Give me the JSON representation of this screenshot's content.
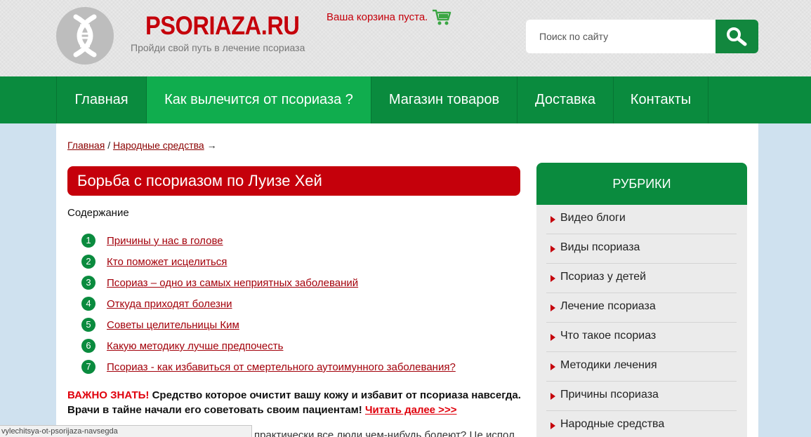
{
  "header": {
    "site_title": "PSORIAZA.RU",
    "tagline": "Пройди свой путь в лечение псориаза",
    "cart_text": "Ваша корзина пуста.",
    "search_placeholder": "Поиск по сайту"
  },
  "nav": {
    "items": [
      {
        "label": "Главная"
      },
      {
        "label": "Как вылечится от псориаза ?"
      },
      {
        "label": "Магазин товаров"
      },
      {
        "label": "Доставка"
      },
      {
        "label": "Контакты"
      }
    ]
  },
  "breadcrumb": {
    "home": "Главная",
    "sep": "/",
    "section": "Народные средства",
    "arrow": "→"
  },
  "article": {
    "title": "Борьба с псориазом по Луизе Хей",
    "toc_label": "Содержание",
    "toc": [
      {
        "num": "1",
        "label": "Причины у нас в голове"
      },
      {
        "num": "2",
        "label": "Кто поможет исцелиться"
      },
      {
        "num": "3",
        "label": "Псориаз – одно из самых неприятных заболеваний"
      },
      {
        "num": "4",
        "label": "Откуда приходят болезни"
      },
      {
        "num": "5",
        "label": "Советы целительницы Ким"
      },
      {
        "num": "6",
        "label": "Какую методику лучше предпочесть"
      },
      {
        "num": "7",
        "label": "Псориаз - как избавиться от смертельного аутоимунного заболевания?"
      }
    ],
    "important_label": "ВАЖНО ЗНАТЬ!",
    "important_text": " Средство которое очистит вашу кожу и избавит от псориаза навсегда. Врачи в тайне начали его советовать своим пациентам! ",
    "read_more": "Читать далее >>>",
    "cut_text": "ь практически все люди чем-нибудь болеют? Це испол"
  },
  "sidebar": {
    "heading": "РУБРИКИ",
    "items": [
      {
        "label": "Видео блоги"
      },
      {
        "label": "Виды псориаза"
      },
      {
        "label": "Псориаз у детей"
      },
      {
        "label": "Лечение псориаза"
      },
      {
        "label": "Что такое псориаз"
      },
      {
        "label": "Методики лечения"
      },
      {
        "label": "Причины псориаза"
      },
      {
        "label": "Народные средства"
      }
    ]
  },
  "statusbar": {
    "url": "vylechitsya-ot-psorijaza-navsegda"
  },
  "colors": {
    "brand_red": "#c5000b",
    "brand_green": "#0a8b3e",
    "active_green": "#10ad4e"
  },
  "icons": [
    "dna-logo-icon",
    "cart-icon",
    "search-icon",
    "arrow-right-icon"
  ]
}
